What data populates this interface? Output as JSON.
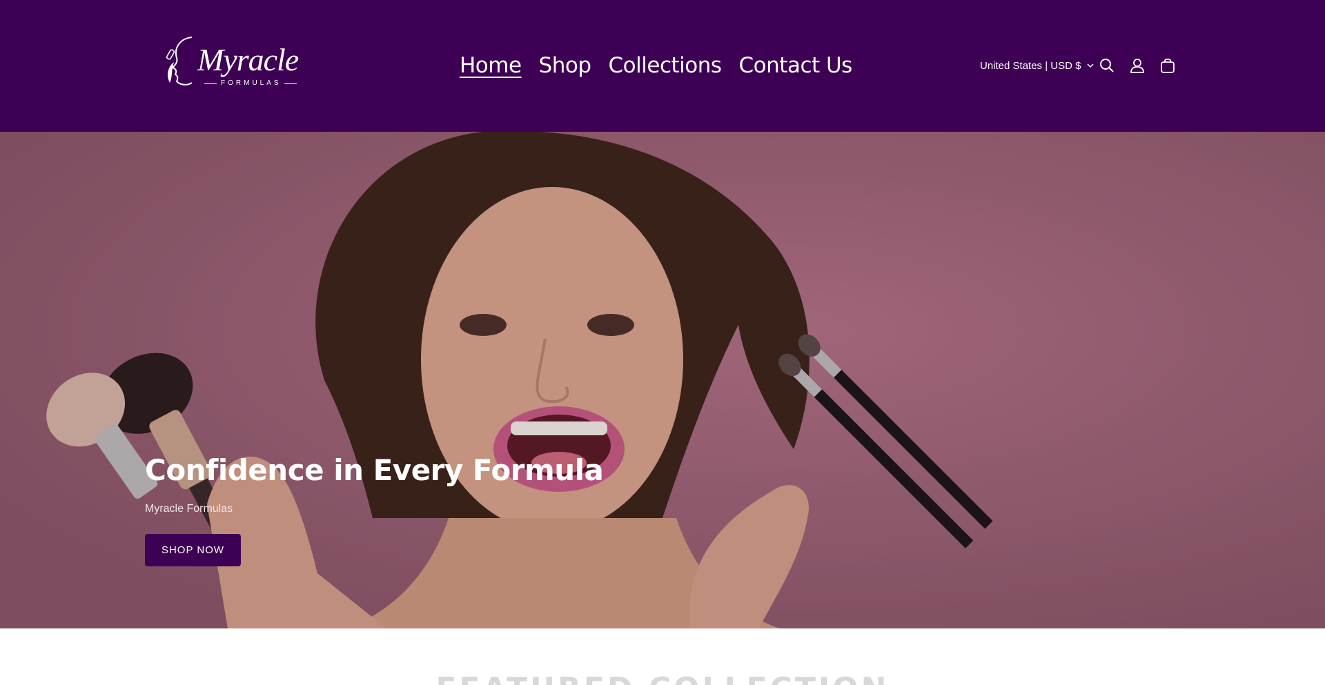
{
  "brand": {
    "logo_word": "Myracle",
    "logo_sub": "FORMULAS"
  },
  "nav": {
    "items": [
      {
        "label": "Home",
        "active": true
      },
      {
        "label": "Shop",
        "active": false
      },
      {
        "label": "Collections",
        "active": false
      },
      {
        "label": "Contact Us",
        "active": false
      }
    ]
  },
  "header": {
    "locale_label": "United States | USD $",
    "icons": [
      "search-icon",
      "account-icon",
      "cart-icon"
    ]
  },
  "hero": {
    "title": "Confidence in Every Formula",
    "subtitle": "Myracle Formulas",
    "button_label": "SHOP NOW"
  },
  "below": {
    "heading": "FEATURED COLLECTION"
  },
  "colors": {
    "header_bg": "#3e0055",
    "button_bg": "#3e0055",
    "hero_bg": "#9a6476",
    "text_light": "#ffffff"
  }
}
